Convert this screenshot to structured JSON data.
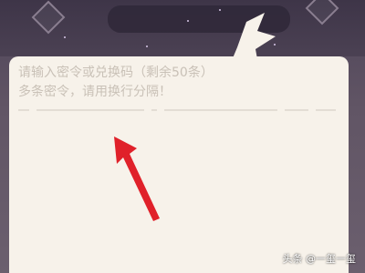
{
  "input": {
    "placeholder_line1": "请输入密令或兑换码（剩余50条）",
    "placeholder_line2": "多条密令，请用换行分隔！"
  },
  "annotation": {
    "arrow_color": "#e0212a",
    "arrow_icon": "red-arrow-icon"
  },
  "watermark": {
    "text": "头条 @一玺一玺"
  },
  "colors": {
    "paper": "#f7f2ea",
    "background": "#5a5060",
    "placeholder_text": "#c9c1b7"
  }
}
